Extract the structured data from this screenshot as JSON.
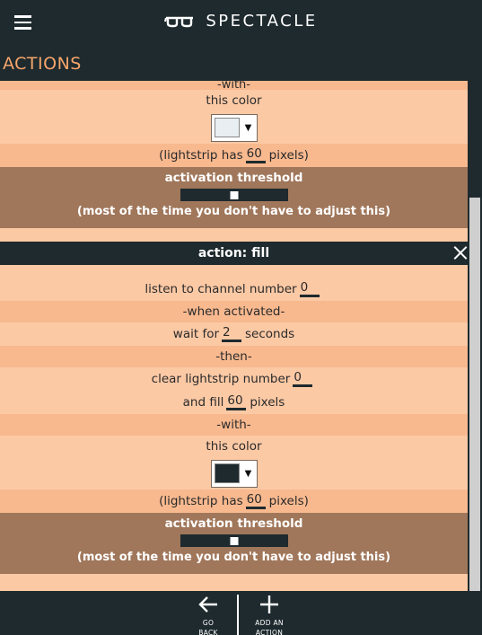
{
  "app": {
    "brand": "SPECTACLE",
    "page_title": "ACTIONS"
  },
  "previous_card": {
    "with_label": "-with-",
    "color_label": "this color",
    "color_value": "#e8eef2",
    "lightstrip_prefix": "(lightstrip has",
    "lightstrip_pixels": "60",
    "lightstrip_suffix": "pixels)",
    "threshold_title": "activation threshold",
    "threshold_level": 0.5,
    "threshold_note": "(most of the time you don't have to adjust this)"
  },
  "fill_card": {
    "title": "action: fill",
    "listen_label": "listen to channel number",
    "channel": "0",
    "when_activated": "-when activated-",
    "wait_prefix": "wait for",
    "wait_seconds": "2",
    "wait_suffix": "seconds",
    "then_label": "-then-",
    "clear_label": "clear lightstrip number",
    "lightstrip_number": "0",
    "fill_prefix": "and fill",
    "fill_pixels": "60",
    "fill_suffix": "pixels",
    "with_label": "-with-",
    "color_label": "this color",
    "color_value": "#1e2a2e",
    "lightstrip_prefix": "(lightstrip has",
    "lightstrip_pixels": "60",
    "lightstrip_suffix": "pixels)",
    "threshold_title": "activation threshold",
    "threshold_level": 0.5,
    "threshold_note": "(most of the time you don't have to adjust this)"
  },
  "footer": {
    "back_line1": "GO",
    "back_line2": "BACK",
    "add_line1": "ADD AN",
    "add_line2": "ACTION"
  },
  "colors": {
    "header_bg": "#1e2a2e",
    "accent": "#f7a56b",
    "row_light": "#fcc9a5",
    "row_dark": "#f8b98f",
    "threshold_bg": "#a0775b"
  },
  "icons": {
    "menu": "hamburger-menu-icon",
    "logo": "glasses-icon",
    "close": "close-icon",
    "back": "arrow-left-icon",
    "add": "plus-icon",
    "dropdown": "triangle-down-icon"
  }
}
